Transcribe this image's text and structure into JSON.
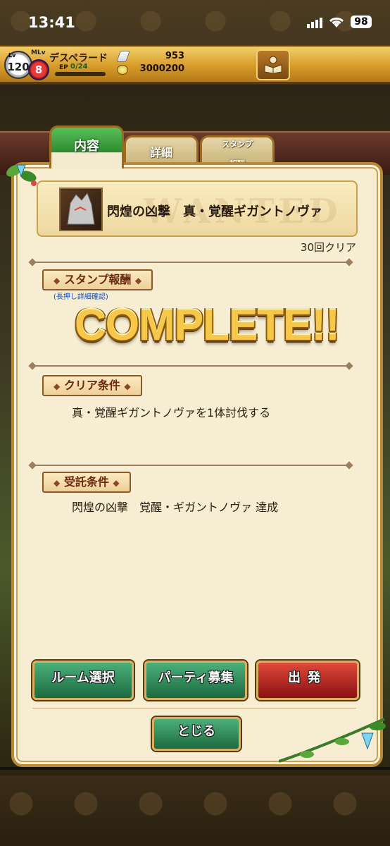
{
  "status_bar": {
    "time": "13:41",
    "battery": "98"
  },
  "hud": {
    "lv_label": "Lv",
    "level": "120",
    "mlv_label": "MLv",
    "mlevel": "8",
    "player_name": "デスペラード",
    "ep_label": "EP",
    "ep_value": "0/24",
    "ep_progress": 0.0,
    "gems": "953",
    "coins": "3000200"
  },
  "tabs": {
    "content": "内容",
    "detail": "詳細",
    "stamp_line1": "スタンプ",
    "stamp_line2": "報酬"
  },
  "quest": {
    "watermark": "WANTED",
    "title": "閃煌の凶撃　真・覚醒ギガントノヴァ",
    "clears": "30回クリア"
  },
  "sections": {
    "stamp_reward": "スタンプ報酬",
    "stamp_hint": "(長押し詳細確認)",
    "complete": "COMPLETE!!",
    "clear_condition": "クリア条件",
    "clear_condition_text": "真・覚醒ギガントノヴァを1体討伐する",
    "accept_condition": "受託条件",
    "accept_condition_text": "閃煌の凶撃　覚醒・ギガントノヴァ 達成"
  },
  "buttons": {
    "room_select": "ルーム選択",
    "party_recruit": "パーティ募集",
    "depart": "出発",
    "close": "とじる"
  },
  "colors": {
    "accent_green": "#2f8a2f",
    "accent_red": "#8a1010",
    "panel": "#f6edd2",
    "gold": "#d79c2a"
  }
}
